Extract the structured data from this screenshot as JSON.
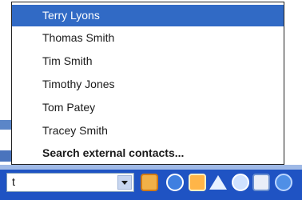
{
  "dropdown": {
    "items": [
      {
        "label": "Terry Lyons",
        "selected": true
      },
      {
        "label": "Thomas Smith"
      },
      {
        "label": "Tim Smith"
      },
      {
        "label": "Timothy Jones"
      },
      {
        "label": "Tom Patey"
      },
      {
        "label": "Tracey Smith"
      },
      {
        "label": "Search external contacts...",
        "bold": true
      }
    ]
  },
  "toolbar": {
    "search_value": "t",
    "icons": [
      "contact-card-icon",
      "back-arrow-icon",
      "mail-icon",
      "home-icon",
      "search-icon",
      "document-icon",
      "globe-icon"
    ]
  },
  "colors": {
    "selection": "#316ac5",
    "toolbar": "#1f53c3"
  }
}
